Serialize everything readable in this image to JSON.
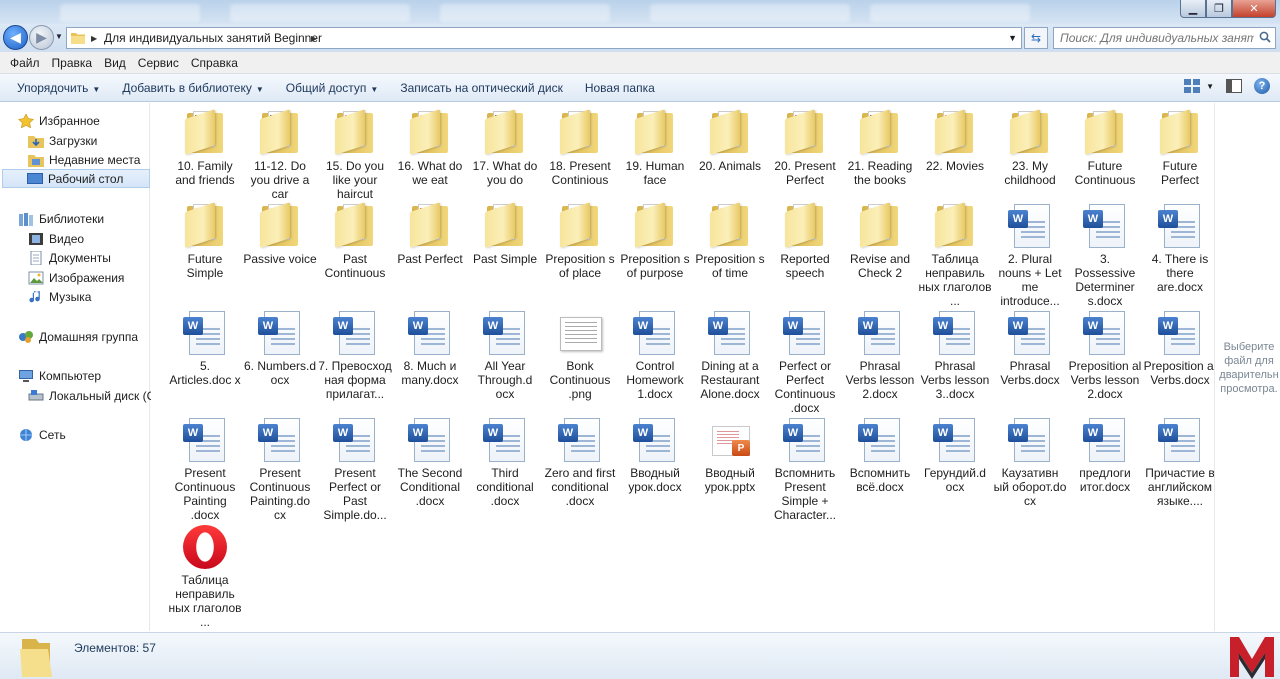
{
  "address": {
    "path": "Для индивидуальных занятий Beginner",
    "search_placeholder": "Поиск: Для индивидуальных заняти..."
  },
  "menu": [
    "Файл",
    "Правка",
    "Вид",
    "Сервис",
    "Справка"
  ],
  "commands": [
    {
      "label": "Упорядочить",
      "dropdown": true
    },
    {
      "label": "Добавить в библиотеку",
      "dropdown": true
    },
    {
      "label": "Общий доступ",
      "dropdown": true
    },
    {
      "label": "Записать на оптический диск",
      "dropdown": false
    },
    {
      "label": "Новая папка",
      "dropdown": false
    }
  ],
  "nav": {
    "favorites": "Избранное",
    "downloads": "Загрузки",
    "recent": "Недавние места",
    "desktop": "Рабочий стол",
    "libraries": "Библиотеки",
    "video": "Видео",
    "documents": "Документы",
    "images": "Изображения",
    "music": "Музыка",
    "homegroup": "Домашняя группа",
    "computer": "Компьютер",
    "localdisk": "Локальный диск (C",
    "network": "Сеть"
  },
  "items": [
    {
      "label": "10. Family and friends",
      "type": "folder",
      "thumb": "#6a4b2a"
    },
    {
      "label": "11-12. Do you drive a car",
      "type": "folder",
      "thumb": "#5b4a3a"
    },
    {
      "label": "15. Do you like your haircut",
      "type": "folder",
      "thumb": "#c46bb0"
    },
    {
      "label": "16. What do we eat",
      "type": "folder",
      "thumb": "#e7d6a1"
    },
    {
      "label": "17. What do you do",
      "type": "folder",
      "thumb": "#3a3a3a"
    },
    {
      "label": "18. Present Continious",
      "type": "folder",
      "thumb": "#eeeeee"
    },
    {
      "label": "19. Human face",
      "type": "folder",
      "thumb": "#f0f0f0"
    },
    {
      "label": "20. Animals",
      "type": "folder",
      "thumb": "#f5f0dd"
    },
    {
      "label": "20. Present Perfect",
      "type": "folder",
      "thumb": "#cf3b2f"
    },
    {
      "label": "21. Reading the books",
      "type": "folder",
      "thumb": "#5a3f2a"
    },
    {
      "label": "22. Movies",
      "type": "folder",
      "thumb": "#e17a7a"
    },
    {
      "label": "23. My childhood",
      "type": "folder",
      "thumb": ""
    },
    {
      "label": "Future Continuous",
      "type": "folder",
      "thumb": "#f0f0f0"
    },
    {
      "label": "Future Perfect",
      "type": "folder",
      "thumb": "#f2f2f2"
    },
    {
      "label": "Future Simple",
      "type": "folder",
      "thumb": "#f4eccd"
    },
    {
      "label": "Passive voice",
      "type": "folder",
      "thumb": "#f0e7c8"
    },
    {
      "label": "Past Continuous",
      "type": "folder",
      "thumb": "#eeeeee"
    },
    {
      "label": "Past Perfect",
      "type": "folder",
      "thumb": "#d84b3e"
    },
    {
      "label": "Past Simple",
      "type": "folder",
      "thumb": "#ede3c0"
    },
    {
      "label": "Preposition s of place",
      "type": "folder",
      "thumb": "#e6e6e6"
    },
    {
      "label": "Preposition s of purpose",
      "type": "folder",
      "thumb": "#d9c9e6"
    },
    {
      "label": "Preposition s of time",
      "type": "folder",
      "thumb": "#e4e4e4"
    },
    {
      "label": "Reported speech",
      "type": "folder",
      "thumb": "#f0e3b5"
    },
    {
      "label": "Revise and Check 2",
      "type": "folder",
      "thumb": "#ece3c4"
    },
    {
      "label": "Таблица неправиль ных глаголов ...",
      "type": "folder",
      "thumb": "#f0e6c6"
    },
    {
      "label": "2. Plural nouns + Let me introduce...",
      "type": "docx"
    },
    {
      "label": "3. Possessive Determiner s.docx",
      "type": "docx"
    },
    {
      "label": "4. There is there are.docx",
      "type": "docx"
    },
    {
      "label": "5. Articles.doc x",
      "type": "docx"
    },
    {
      "label": "6. Numbers.d ocx",
      "type": "docx"
    },
    {
      "label": "7. Превосход ная форма прилагат...",
      "type": "docx"
    },
    {
      "label": "8. Much и many.docx",
      "type": "docx"
    },
    {
      "label": "All Year Through.d ocx",
      "type": "docx"
    },
    {
      "label": "Bonk Continuous .png",
      "type": "png"
    },
    {
      "label": "Control Homework 1.docx",
      "type": "docx"
    },
    {
      "label": "Dining at a Restaurant Alone.docx",
      "type": "docx"
    },
    {
      "label": "Perfect or Perfect Continuous .docx",
      "type": "docx"
    },
    {
      "label": "Phrasal Verbs lesson 2.docx",
      "type": "docx"
    },
    {
      "label": "Phrasal Verbs lesson 3..docx",
      "type": "docx"
    },
    {
      "label": "Phrasal Verbs.docx",
      "type": "docx"
    },
    {
      "label": "Preposition al Verbs lesson 2.docx",
      "type": "docx"
    },
    {
      "label": "Preposition al Verbs.docx",
      "type": "docx"
    },
    {
      "label": "Present Continuous Painting .docx",
      "type": "docx"
    },
    {
      "label": "Present Continuous Painting.do cx",
      "type": "docx"
    },
    {
      "label": "Present Perfect or Past Simple.do...",
      "type": "docx"
    },
    {
      "label": "The Second Conditional .docx",
      "type": "docx"
    },
    {
      "label": "Third conditional .docx",
      "type": "docx"
    },
    {
      "label": "Zero and first conditional .docx",
      "type": "docx"
    },
    {
      "label": "Вводный урок.docx",
      "type": "docx"
    },
    {
      "label": "Вводный урок.pptx",
      "type": "pptx"
    },
    {
      "label": "Вспомнить Present Simple + Character...",
      "type": "docx"
    },
    {
      "label": "Вспомнить всё.docx",
      "type": "docx"
    },
    {
      "label": "Герундий.d ocx",
      "type": "docx"
    },
    {
      "label": "Каузативн ый оборот.do cx",
      "type": "docx"
    },
    {
      "label": "предлоги итог.docx",
      "type": "docx"
    },
    {
      "label": "Причастие в английском языке....",
      "type": "docx"
    },
    {
      "label": "Таблица неправиль ных глаголов ...",
      "type": "opera"
    }
  ],
  "preview_text": "Выберите файл для дварительн просмотра.",
  "status": {
    "count_text": "Элементов: 57"
  },
  "colors": {
    "logo_red": "#c8202a",
    "logo_dark": "#2b2b33"
  }
}
